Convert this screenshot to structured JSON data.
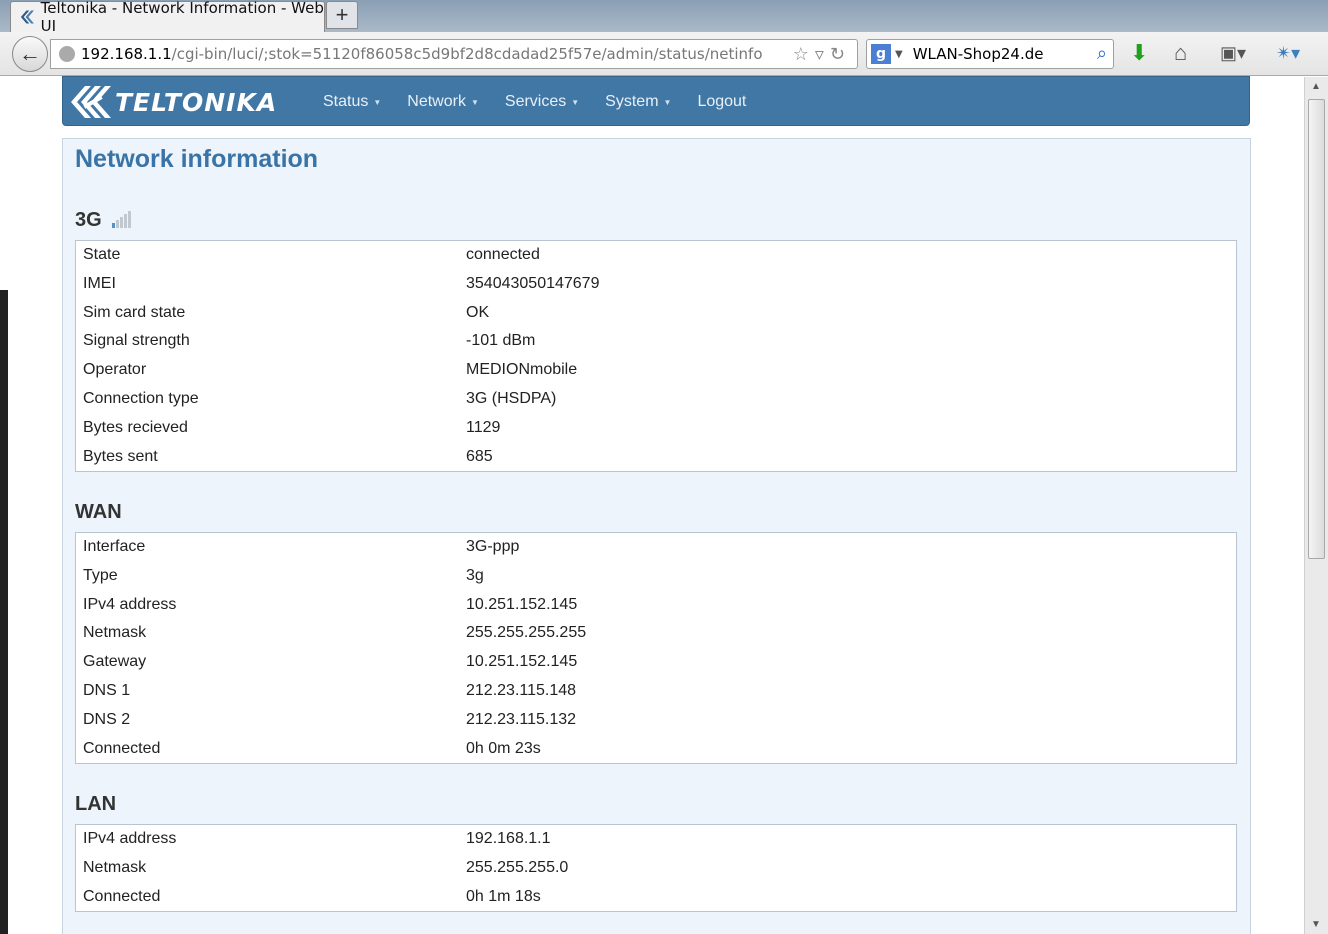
{
  "browser": {
    "tab_title": "Teltonika - Network Information - Web UI",
    "new_tab": "+",
    "url_host": "192.168.1.1",
    "url_path": "/cgi-bin/luci/;stok=51120f86058c5d9bf2d8cdadad25f57e/admin/status/netinfo",
    "search_engine": "g",
    "search_value": "WLAN-Shop24.de"
  },
  "header": {
    "logo": "TELTONIKA",
    "menu": [
      {
        "label": "Status"
      },
      {
        "label": "Network"
      },
      {
        "label": "Services"
      },
      {
        "label": "System"
      },
      {
        "label": "Logout"
      }
    ]
  },
  "page": {
    "title": "Network information"
  },
  "sections": {
    "g3": {
      "title": "3G",
      "rows": [
        {
          "key": "State",
          "value": "connected"
        },
        {
          "key": "IMEI",
          "value": "354043050147679"
        },
        {
          "key": "Sim card state",
          "value": "OK"
        },
        {
          "key": "Signal strength",
          "value": "-101 dBm"
        },
        {
          "key": "Operator",
          "value": "MEDIONmobile"
        },
        {
          "key": "Connection type",
          "value": "3G (HSDPA)"
        },
        {
          "key": "Bytes recieved",
          "value": "1129"
        },
        {
          "key": "Bytes sent",
          "value": "685"
        }
      ]
    },
    "wan": {
      "title": "WAN",
      "rows": [
        {
          "key": "Interface",
          "value": "3G-ppp"
        },
        {
          "key": "Type",
          "value": "3g"
        },
        {
          "key": "IPv4 address",
          "value": "10.251.152.145"
        },
        {
          "key": "Netmask",
          "value": "255.255.255.255"
        },
        {
          "key": "Gateway",
          "value": "10.251.152.145"
        },
        {
          "key": "DNS 1",
          "value": "212.23.115.148"
        },
        {
          "key": "DNS 2",
          "value": "212.23.115.132"
        },
        {
          "key": "Connected",
          "value": "0h 0m 23s"
        }
      ]
    },
    "lan": {
      "title": "LAN",
      "rows": [
        {
          "key": "IPv4 address",
          "value": "192.168.1.1"
        },
        {
          "key": "Netmask",
          "value": "255.255.255.0"
        },
        {
          "key": "Connected",
          "value": "0h 1m 18s"
        }
      ]
    }
  },
  "colors": {
    "header_bg": "#4177a5",
    "title_color": "#3a74a6",
    "panel_bg": "#eef4fb"
  }
}
